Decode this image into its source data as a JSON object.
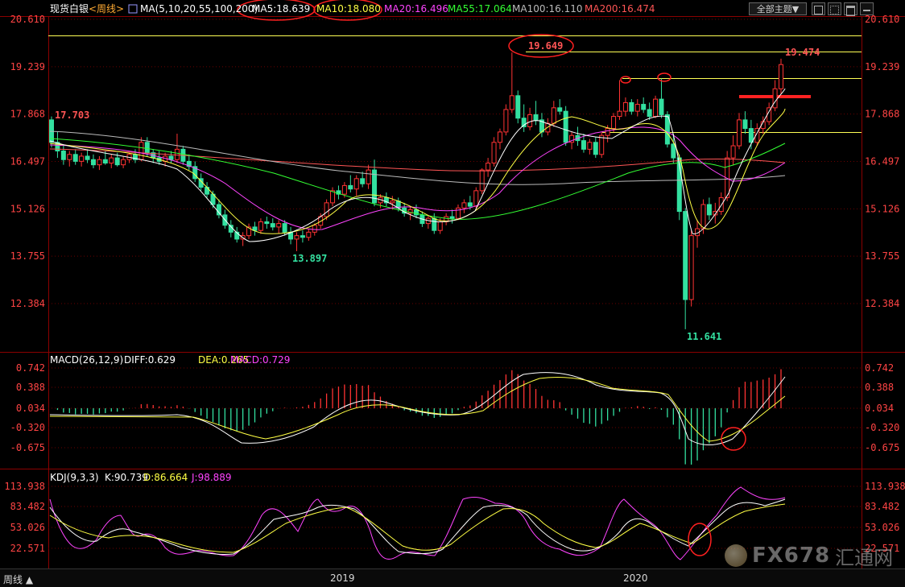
{
  "header": {
    "instrument": "现货白银",
    "period_link": "<周线>",
    "ma_params": "MA(5,10,20,55,100,200)",
    "ma": [
      {
        "label": "MA5:18.639",
        "color": "#ffffff"
      },
      {
        "label": "MA10:18.080",
        "color": "#ffff44"
      },
      {
        "label": "MA20:16.496",
        "color": "#ff44ff"
      },
      {
        "label": "MA55:17.064",
        "color": "#33ff33"
      },
      {
        "label": "MA100:16.110",
        "color": "#bbbbbb"
      },
      {
        "label": "MA200:16.474",
        "color": "#ff5555"
      }
    ],
    "theme_button": "全部主题▼"
  },
  "price_axis": [
    "20.610",
    "19.239",
    "17.868",
    "16.497",
    "15.126",
    "13.755",
    "12.384"
  ],
  "annotations": {
    "start": "17.703",
    "low1": "13.897",
    "high1": "19.649",
    "low2": "11.641",
    "last_high": "19.474"
  },
  "macd": {
    "title": "MACD(26,12,9)",
    "diff": "DIFF:0.629",
    "dea": "DEA:0.265",
    "macd": "MACD:0.729",
    "axis": [
      "0.742",
      "0.388",
      "0.034",
      "-0.320",
      "-0.675"
    ]
  },
  "kdj": {
    "title": "KDJ(9,3,3)",
    "k": "K:90.739",
    "d": "D:86.664",
    "j": "J:98.889",
    "axis": [
      "113.938",
      "83.482",
      "53.026",
      "22.571"
    ]
  },
  "footer": {
    "period": "周线 ▲",
    "years": [
      {
        "label": "2019"
      },
      {
        "label": "2020"
      }
    ],
    "watermark": "FX678",
    "watermark_cn": "汇通网"
  },
  "colors": {
    "up": "#ff3333",
    "down": "#33e0a0",
    "grid": "#8b0000",
    "axis_text": "#ff4444",
    "ma5": "#ffffff",
    "ma10": "#ffff44",
    "ma20": "#ff44ff",
    "ma55": "#33ff33",
    "ma100": "#bbbbbb",
    "ma200": "#ff5555"
  },
  "chart_data": {
    "type": "candlestick",
    "y_range": [
      11.5,
      20.8
    ],
    "candles_ohlc": [
      [
        17.7,
        17.8,
        16.9,
        17.05
      ],
      [
        17.05,
        17.35,
        16.6,
        16.8
      ],
      [
        16.8,
        16.95,
        16.4,
        16.55
      ],
      [
        16.55,
        16.8,
        16.35,
        16.7
      ],
      [
        16.7,
        16.85,
        16.4,
        16.5
      ],
      [
        16.5,
        16.75,
        16.35,
        16.65
      ],
      [
        16.65,
        16.85,
        16.45,
        16.55
      ],
      [
        16.55,
        16.7,
        16.3,
        16.4
      ],
      [
        16.4,
        16.65,
        16.25,
        16.55
      ],
      [
        16.55,
        16.8,
        16.4,
        16.45
      ],
      [
        16.45,
        16.7,
        16.3,
        16.6
      ],
      [
        16.6,
        16.75,
        16.35,
        16.4
      ],
      [
        16.4,
        16.65,
        16.3,
        16.55
      ],
      [
        16.55,
        16.75,
        16.45,
        16.7
      ],
      [
        16.7,
        16.85,
        16.45,
        16.55
      ],
      [
        16.55,
        17.2,
        16.5,
        17.05
      ],
      [
        17.05,
        17.2,
        16.65,
        16.75
      ],
      [
        16.75,
        16.85,
        16.45,
        16.6
      ],
      [
        16.6,
        16.8,
        16.4,
        16.5
      ],
      [
        16.5,
        16.75,
        16.35,
        16.65
      ],
      [
        16.65,
        16.8,
        16.45,
        16.55
      ],
      [
        16.55,
        17.3,
        16.45,
        16.85
      ],
      [
        16.85,
        16.95,
        16.4,
        16.5
      ],
      [
        16.5,
        16.7,
        16.25,
        16.35
      ],
      [
        16.35,
        16.5,
        15.9,
        16.0
      ],
      [
        16.0,
        16.15,
        15.65,
        15.75
      ],
      [
        15.75,
        15.9,
        15.45,
        15.55
      ],
      [
        15.55,
        15.65,
        15.15,
        15.25
      ],
      [
        15.25,
        15.4,
        14.85,
        14.95
      ],
      [
        14.95,
        15.1,
        14.55,
        14.65
      ],
      [
        14.65,
        14.8,
        14.3,
        14.45
      ],
      [
        14.45,
        14.6,
        14.15,
        14.25
      ],
      [
        14.25,
        14.45,
        14.05,
        14.35
      ],
      [
        14.35,
        14.7,
        14.25,
        14.6
      ],
      [
        14.6,
        14.75,
        14.35,
        14.5
      ],
      [
        14.5,
        14.85,
        14.4,
        14.75
      ],
      [
        14.75,
        14.9,
        14.55,
        14.7
      ],
      [
        14.7,
        14.85,
        14.5,
        14.6
      ],
      [
        14.6,
        14.8,
        14.4,
        14.7
      ],
      [
        14.7,
        14.8,
        14.35,
        14.45
      ],
      [
        14.45,
        14.6,
        14.1,
        14.25
      ],
      [
        14.25,
        14.45,
        13.9,
        14.35
      ],
      [
        14.35,
        14.5,
        14.15,
        14.3
      ],
      [
        14.3,
        14.55,
        14.2,
        14.45
      ],
      [
        14.45,
        14.7,
        14.35,
        14.65
      ],
      [
        14.65,
        15.0,
        14.55,
        14.9
      ],
      [
        14.9,
        15.4,
        14.8,
        15.3
      ],
      [
        15.3,
        15.75,
        15.2,
        15.65
      ],
      [
        15.65,
        15.8,
        15.4,
        15.55
      ],
      [
        15.55,
        15.9,
        15.45,
        15.8
      ],
      [
        15.8,
        16.1,
        15.6,
        15.7
      ],
      [
        15.7,
        16.1,
        15.5,
        16.0
      ],
      [
        16.0,
        16.2,
        15.75,
        15.85
      ],
      [
        15.85,
        16.4,
        15.7,
        16.25
      ],
      [
        16.25,
        16.55,
        15.2,
        15.3
      ],
      [
        15.3,
        15.55,
        15.15,
        15.45
      ],
      [
        15.45,
        15.6,
        15.2,
        15.3
      ],
      [
        15.3,
        15.5,
        15.1,
        15.35
      ],
      [
        15.35,
        15.45,
        15.05,
        15.15
      ],
      [
        15.15,
        15.3,
        14.9,
        15.0
      ],
      [
        15.0,
        15.2,
        14.8,
        15.1
      ],
      [
        15.1,
        15.25,
        14.85,
        14.95
      ],
      [
        14.95,
        15.05,
        14.6,
        14.7
      ],
      [
        14.7,
        14.95,
        14.55,
        14.85
      ],
      [
        14.85,
        15.0,
        14.4,
        14.5
      ],
      [
        14.5,
        14.85,
        14.4,
        14.75
      ],
      [
        14.75,
        15.0,
        14.65,
        14.9
      ],
      [
        14.9,
        15.1,
        14.7,
        14.85
      ],
      [
        14.85,
        15.25,
        14.8,
        15.15
      ],
      [
        15.15,
        15.4,
        15.0,
        15.3
      ],
      [
        15.3,
        15.5,
        15.1,
        15.2
      ],
      [
        15.2,
        15.75,
        15.15,
        15.65
      ],
      [
        15.65,
        16.3,
        15.55,
        16.25
      ],
      [
        16.25,
        16.6,
        16.05,
        16.45
      ],
      [
        16.45,
        17.2,
        16.35,
        17.05
      ],
      [
        17.05,
        17.45,
        16.85,
        17.35
      ],
      [
        17.35,
        18.15,
        17.25,
        18.0
      ],
      [
        18.0,
        19.65,
        17.9,
        18.4
      ],
      [
        18.4,
        18.55,
        17.6,
        17.75
      ],
      [
        17.75,
        18.15,
        17.35,
        17.5
      ],
      [
        17.5,
        18.05,
        17.4,
        17.85
      ],
      [
        17.85,
        18.25,
        17.55,
        17.7
      ],
      [
        17.7,
        17.9,
        17.2,
        17.35
      ],
      [
        17.35,
        17.75,
        17.25,
        17.6
      ],
      [
        17.6,
        18.25,
        17.5,
        18.05
      ],
      [
        18.05,
        18.3,
        17.85,
        17.95
      ],
      [
        17.95,
        18.1,
        16.95,
        17.05
      ],
      [
        17.05,
        17.35,
        16.85,
        17.25
      ],
      [
        17.25,
        17.5,
        16.95,
        17.1
      ],
      [
        17.1,
        17.3,
        16.75,
        16.85
      ],
      [
        16.85,
        17.15,
        16.7,
        17.05
      ],
      [
        17.05,
        17.2,
        16.6,
        16.7
      ],
      [
        16.7,
        17.35,
        16.6,
        17.25
      ],
      [
        17.25,
        17.55,
        17.05,
        17.45
      ],
      [
        17.45,
        17.9,
        17.35,
        17.8
      ],
      [
        17.8,
        18.85,
        17.7,
        17.95
      ],
      [
        17.95,
        18.35,
        17.8,
        18.2
      ],
      [
        18.2,
        18.3,
        17.85,
        17.95
      ],
      [
        17.95,
        18.3,
        17.8,
        18.15
      ],
      [
        18.15,
        18.35,
        17.9,
        18.0
      ],
      [
        18.0,
        18.2,
        17.7,
        17.8
      ],
      [
        17.8,
        18.4,
        17.75,
        18.3
      ],
      [
        18.3,
        18.9,
        17.75,
        17.85
      ],
      [
        17.85,
        17.95,
        16.9,
        17.0
      ],
      [
        17.0,
        17.3,
        16.45,
        16.6
      ],
      [
        16.6,
        16.7,
        14.8,
        15.05
      ],
      [
        15.05,
        15.15,
        11.64,
        12.5
      ],
      [
        12.5,
        14.5,
        12.3,
        14.35
      ],
      [
        14.35,
        14.8,
        14.0,
        14.55
      ],
      [
        14.55,
        15.4,
        14.4,
        15.25
      ],
      [
        15.25,
        15.45,
        14.8,
        14.95
      ],
      [
        14.95,
        15.3,
        14.7,
        15.05
      ],
      [
        15.05,
        15.6,
        14.95,
        15.45
      ],
      [
        15.45,
        16.8,
        15.35,
        16.6
      ],
      [
        16.6,
        17.25,
        16.4,
        16.95
      ],
      [
        16.95,
        17.9,
        16.85,
        17.7
      ],
      [
        17.7,
        17.95,
        17.3,
        17.45
      ],
      [
        17.45,
        17.7,
        16.85,
        17.05
      ],
      [
        17.05,
        17.6,
        16.95,
        17.45
      ],
      [
        17.45,
        17.8,
        17.3,
        17.65
      ],
      [
        17.65,
        18.2,
        17.55,
        18.05
      ],
      [
        18.05,
        18.85,
        17.95,
        18.6
      ],
      [
        18.6,
        19.47,
        18.45,
        19.3
      ]
    ]
  }
}
